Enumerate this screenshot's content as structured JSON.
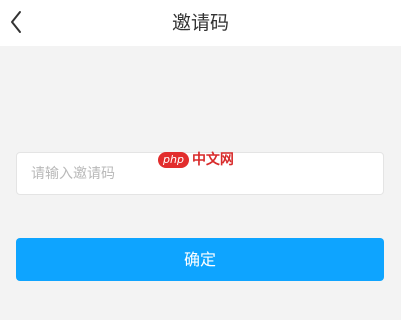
{
  "header": {
    "back_icon": "chevron-left-icon",
    "title": "邀请码"
  },
  "form": {
    "code_placeholder": "请输入邀请码",
    "code_value": ""
  },
  "watermark": {
    "badge_text": "php",
    "text": "中文网"
  },
  "actions": {
    "confirm_label": "确定"
  },
  "colors": {
    "primary": "#0ea4ff",
    "page_background": "#f3f3f3",
    "title_text": "#333333",
    "placeholder_text": "#b9b9b9"
  }
}
